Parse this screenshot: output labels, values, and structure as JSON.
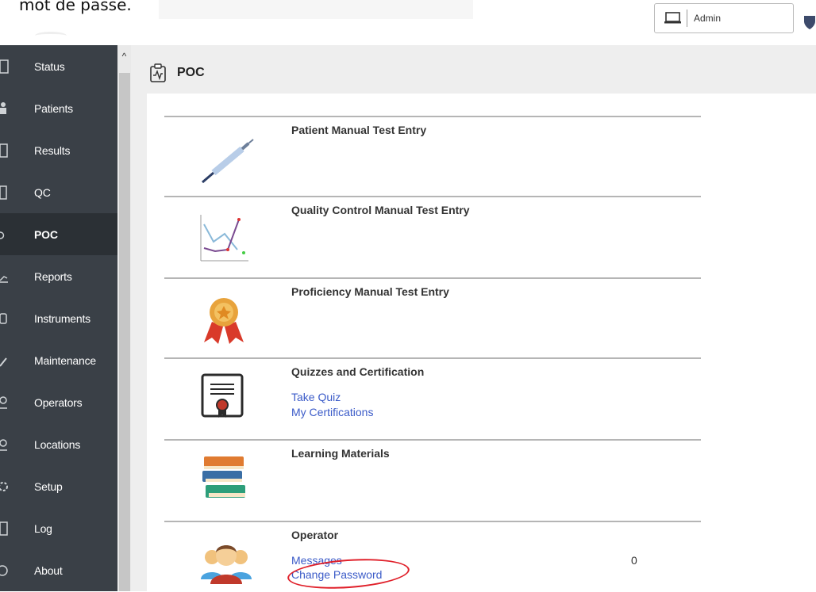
{
  "caption": {
    "text": "mot de passe."
  },
  "user": {
    "name": "Admin"
  },
  "sidebar": {
    "items": [
      {
        "label": "Status",
        "active": false
      },
      {
        "label": "Patients",
        "active": false
      },
      {
        "label": "Results",
        "active": false
      },
      {
        "label": "QC",
        "active": false
      },
      {
        "label": "POC",
        "active": true
      },
      {
        "label": "Reports",
        "active": false
      },
      {
        "label": "Instruments",
        "active": false
      },
      {
        "label": "Maintenance",
        "active": false
      },
      {
        "label": "Operators",
        "active": false
      },
      {
        "label": "Locations",
        "active": false
      },
      {
        "label": "Setup",
        "active": false
      },
      {
        "label": "Log",
        "active": false
      },
      {
        "label": "About",
        "active": false
      }
    ]
  },
  "page": {
    "title": "POC"
  },
  "sections": {
    "patient_manual": {
      "title": "Patient Manual Test Entry"
    },
    "qc_manual": {
      "title": "Quality Control Manual Test Entry"
    },
    "proficiency": {
      "title": "Proficiency Manual Test Entry"
    },
    "quizzes": {
      "title": "Quizzes and Certification",
      "take_quiz": "Take Quiz",
      "my_certifications": "My Certifications"
    },
    "learning": {
      "title": "Learning Materials"
    },
    "operator": {
      "title": "Operator",
      "messages": "Messages",
      "messages_count": "0",
      "change_password": "Change Password"
    }
  },
  "colors": {
    "sidebar_bg": "#3a4047",
    "sidebar_active": "#2b3035",
    "link": "#3b5bc8",
    "annotation_circle": "#e0202a"
  }
}
